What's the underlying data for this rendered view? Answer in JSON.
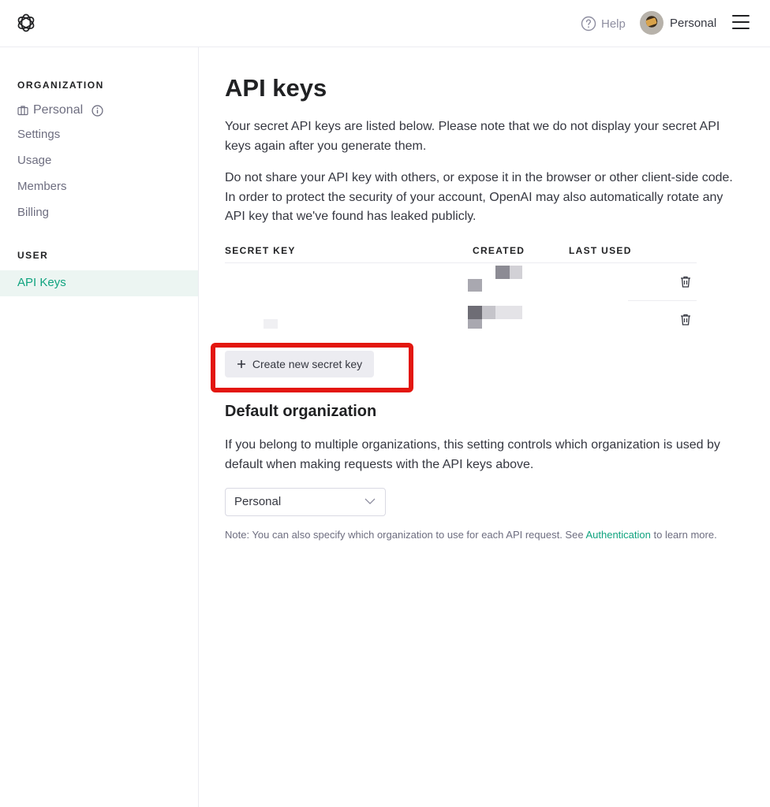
{
  "header": {
    "logo_icon": "openai-logo-icon",
    "help_label": "Help",
    "help_icon": "question-circle-icon",
    "account_label": "Personal",
    "menu_icon": "hamburger-menu-icon"
  },
  "sidebar": {
    "org_heading": "ORGANIZATION",
    "org_name": "Personal",
    "org_items": [
      "Settings",
      "Usage",
      "Members",
      "Billing"
    ],
    "user_heading": "USER",
    "active_item": "API Keys"
  },
  "main": {
    "title": "API keys",
    "intro": "Your secret API keys are listed below. Please note that we do not display your secret API keys again after you generate them.",
    "warning": "Do not share your API key with others, or expose it in the browser or other client-side code. In order to protect the security of your account, OpenAI may also automatically rotate any API key that we've found has leaked publicly.",
    "table": {
      "columns": [
        "SECRET KEY",
        "CREATED",
        "LAST USED"
      ],
      "rows": 2
    },
    "create_button": "Create new secret key",
    "default_org_title": "Default organization",
    "default_org_desc": "If you belong to multiple organizations, this setting controls which organization is used by default when making requests with the API keys above.",
    "org_select_value": "Personal",
    "note_before": "Note: You can also specify which organization to use for each API request. See ",
    "note_link": "Authentication",
    "note_after": " to learn more."
  },
  "colors": {
    "accent": "#10a37f",
    "highlight_box": "#e3170f"
  }
}
